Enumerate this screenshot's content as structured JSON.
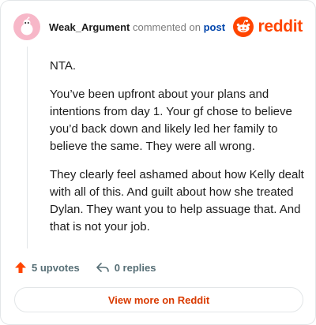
{
  "comment": {
    "author": "Weak_Argument",
    "action_text": "commented on",
    "post_link": "post",
    "paragraphs": [
      "NTA.",
      "You’ve been upfront about your plans and intentions from day 1. Your gf chose to believe you’d back down and likely led her family to believe the same. They were all wrong.",
      "They clearly feel ashamed about how Kelly dealt with all of this. And guilt about how she treated Dylan. They want you to help assuage that. And that is not your job."
    ]
  },
  "brand": {
    "name": "reddit",
    "color": "#ff4500",
    "icon": "reddit-logo-icon"
  },
  "actions": {
    "upvotes": "5 upvotes",
    "replies": "0 replies"
  },
  "footer": {
    "view_more": "View more on Reddit"
  }
}
